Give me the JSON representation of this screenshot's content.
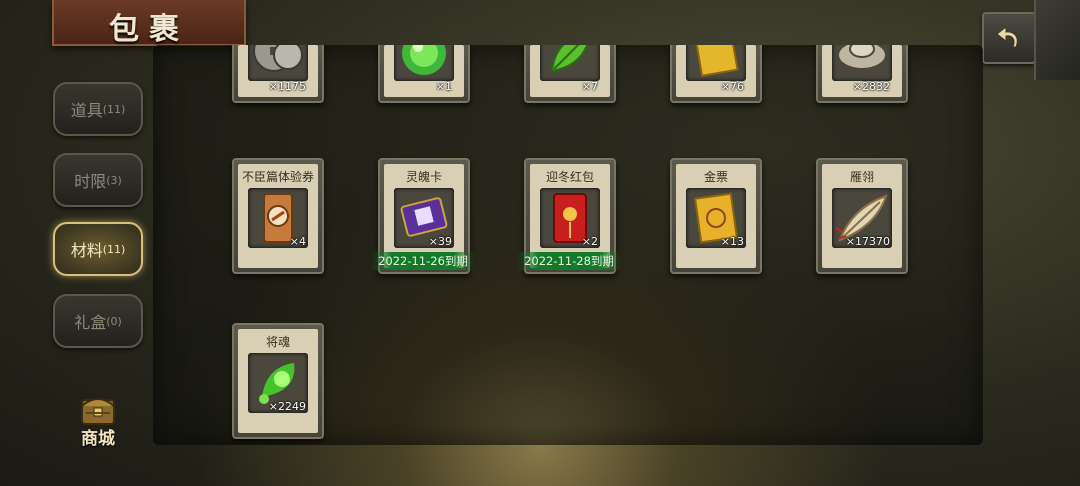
{
  "title": "包裹",
  "tabs": [
    {
      "label": "道具",
      "count": "(11)"
    },
    {
      "label": "时限",
      "count": "(3)"
    },
    {
      "label": "材料",
      "count": "(11)"
    },
    {
      "label": "礼盒",
      "count": "(0)"
    }
  ],
  "active_tab": "材料",
  "shop_label": "商城",
  "top_row_items": [
    {
      "qty": "×1175",
      "icon": "coins-icon"
    },
    {
      "qty": "×1",
      "icon": "green-orb-icon"
    },
    {
      "qty": "×7",
      "icon": "leaf-icon"
    },
    {
      "qty": "×76",
      "icon": "gold-scroll-icon"
    },
    {
      "qty": "×2832",
      "icon": "silver-ingot-icon"
    }
  ],
  "items": [
    {
      "name": "不臣篇体验券",
      "qty": "×4",
      "icon": "voucher-icon"
    },
    {
      "name": "灵魄卡",
      "qty": "×39",
      "icon": "soul-card-icon",
      "expiry": "2022-11-26到期"
    },
    {
      "name": "迎冬红包",
      "qty": "×2",
      "icon": "red-envelope-icon",
      "expiry": "2022-11-28到期"
    },
    {
      "name": "金票",
      "qty": "×13",
      "icon": "gold-ticket-icon"
    },
    {
      "name": "雁翎",
      "qty": "×17370",
      "icon": "feather-icon"
    },
    {
      "name": "将魂",
      "qty": "×2249",
      "icon": "general-soul-icon"
    }
  ],
  "colors": {
    "accent_gold": "#d8c27a",
    "expiry_green": "#137a2a",
    "title_red": "#6b3a26"
  }
}
